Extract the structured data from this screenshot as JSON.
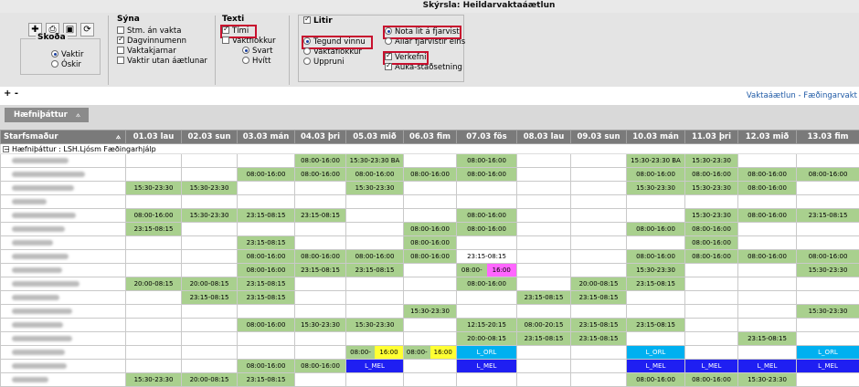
{
  "report_title": "Skýrsla: Heildarvaktaáætlun",
  "toolbar": {
    "icons": [
      "add-icon",
      "print-icon",
      "export-icon",
      "refresh-icon"
    ]
  },
  "skoda": {
    "title": "Skoða",
    "options": [
      "Vaktir",
      "Óskir"
    ],
    "selected": "Vaktir"
  },
  "syna": {
    "title": "Sýna",
    "items": [
      {
        "label": "Stm. án vakta",
        "checked": false
      },
      {
        "label": "Dagvinnumenn",
        "checked": true
      },
      {
        "label": "Vaktakjarnar",
        "checked": false
      },
      {
        "label": "Vaktir utan áætlunar",
        "checked": false
      }
    ]
  },
  "texti": {
    "title": "Texti",
    "items": [
      {
        "label": "Tími",
        "checked": true
      },
      {
        "label": "Vaktflokkur",
        "checked": false
      }
    ],
    "radios": [
      "Svart",
      "Hvítt"
    ],
    "selected": "Svart"
  },
  "litir": {
    "title": "Litir",
    "checked": true,
    "radios": [
      "Tegund vinnu",
      "Vaktaflokkur",
      "Uppruni"
    ],
    "selected": "Tegund vinnu"
  },
  "nota": {
    "radios": [
      "Nota lit á fjarvist",
      "Allar fjarvistir eins"
    ],
    "selected": "Nota lit á fjarvist",
    "checks": [
      {
        "label": "Verkefni",
        "checked": true
      },
      {
        "label": "Auka-staðsetning",
        "checked": true
      }
    ]
  },
  "expand_label": "+ -",
  "breadcrumb": "Vaktaáætlun - Fæðingarvakt",
  "group_chip": "Hæfniþáttur",
  "table": {
    "first_header": "Starfsmaður",
    "dates": [
      "01.03 lau",
      "02.03 sun",
      "03.03 mán",
      "04.03 þri",
      "05.03 mið",
      "06.03 fim",
      "07.03 fös",
      "08.03 lau",
      "09.03 sun",
      "10.03 mán",
      "11.03 þri",
      "12.03 mið",
      "13.03 fim"
    ],
    "group_row": "Hæfniþáttur : LSH.Ljósm Fæðingarhjálp",
    "rows": [
      [
        "",
        "",
        "",
        "08:00-16:00",
        "15:30-23:30 BA",
        "",
        "08:00-16:00",
        "",
        "",
        "15:30-23:30 BA",
        "15:30-23:30",
        "",
        ""
      ],
      [
        "",
        "",
        "08:00-16:00",
        "08:00-16:00",
        "08:00-16:00",
        "08:00-16:00",
        "08:00-16:00",
        "",
        "",
        "08:00-16:00",
        "08:00-16:00",
        "08:00-16:00",
        "08:00-16:00"
      ],
      [
        "15:30-23:30",
        "15:30-23:30",
        "",
        "",
        "15:30-23:30",
        "",
        "",
        "",
        "",
        "15:30-23:30",
        "15:30-23:30",
        "08:00-16:00",
        ""
      ],
      [
        "",
        "",
        "",
        "",
        "",
        "",
        "",
        "",
        "",
        "",
        "",
        "",
        ""
      ],
      [
        "08:00-16:00",
        "15:30-23:30",
        "23:15-08:15",
        "23:15-08:15",
        "",
        "",
        "08:00-16:00",
        "",
        "",
        "",
        "15:30-23:30",
        "08:00-16:00",
        "23:15-08:15"
      ],
      [
        "23:15-08:15",
        "",
        "",
        "",
        "",
        "08:00-16:00",
        "08:00-16:00",
        "",
        "",
        "08:00-16:00",
        "08:00-16:00",
        "",
        ""
      ],
      [
        "",
        "",
        "23:15-08:15",
        "",
        "",
        "08:00-16:00",
        "",
        "",
        "",
        "",
        "08:00-16:00",
        "",
        ""
      ],
      [
        "",
        "",
        "08:00-16:00",
        "08:00-16:00",
        "08:00-16:00",
        "08:00-16:00",
        "23:15-08:15",
        "",
        "",
        "08:00-16:00",
        "08:00-16:00",
        "08:00-16:00",
        "08:00-16:00"
      ],
      [
        "",
        "",
        "08:00-16:00",
        "23:15-08:15",
        "23:15-08:15",
        "",
        "08:00-16:00",
        "",
        "",
        "15:30-23:30",
        "",
        "",
        "15:30-23:30"
      ],
      [
        "20:00-08:15",
        "20:00-08:15",
        "23:15-08:15",
        "",
        "",
        "",
        "08:00-16:00",
        "",
        "20:00-08:15",
        "23:15-08:15",
        "",
        "",
        ""
      ],
      [
        "",
        "23:15-08:15",
        "23:15-08:15",
        "",
        "",
        "",
        "",
        "23:15-08:15",
        "23:15-08:15",
        "",
        "",
        "",
        ""
      ],
      [
        "",
        "",
        "",
        "",
        "",
        "15:30-23:30",
        "",
        "",
        "",
        "",
        "",
        "",
        "15:30-23:30"
      ],
      [
        "",
        "",
        "08:00-16:00",
        "15:30-23:30",
        "15:30-23:30",
        "",
        "12:15-20:15",
        "08:00-20:15",
        "23:15-08:15",
        "23:15-08:15",
        "",
        "",
        ""
      ],
      [
        "",
        "",
        "",
        "",
        "",
        "",
        "20:00-08:15",
        "23:15-08:15",
        "23:15-08:15",
        "",
        "",
        "23:15-08:15",
        ""
      ],
      [
        "",
        "",
        "",
        "",
        "08:00-16:00",
        "08:00-16:00",
        "L_ORL",
        "",
        "",
        "L_ORL",
        "",
        "",
        "L_ORL"
      ],
      [
        "",
        "",
        "08:00-16:00",
        "08:00-16:00",
        "L_MEL",
        "",
        "L_MEL",
        "",
        "",
        "L_MEL",
        "L_MEL",
        "L_MEL",
        "L_MEL"
      ],
      [
        "15:30-23:30",
        "20:00-08:15",
        "23:15-08:15",
        "",
        "",
        "",
        "",
        "",
        "",
        "08:00-16:00",
        "08:00-16:00",
        "15:30-23:30",
        ""
      ]
    ],
    "last_row_name": "Elsa Bettý Vald..."
  },
  "colors": {
    "shift": "#a9d08e",
    "highlight": "#ffff33",
    "magenta": "#ff66ff",
    "mel": "#1f1ff2",
    "orl": "#00b0f0"
  }
}
